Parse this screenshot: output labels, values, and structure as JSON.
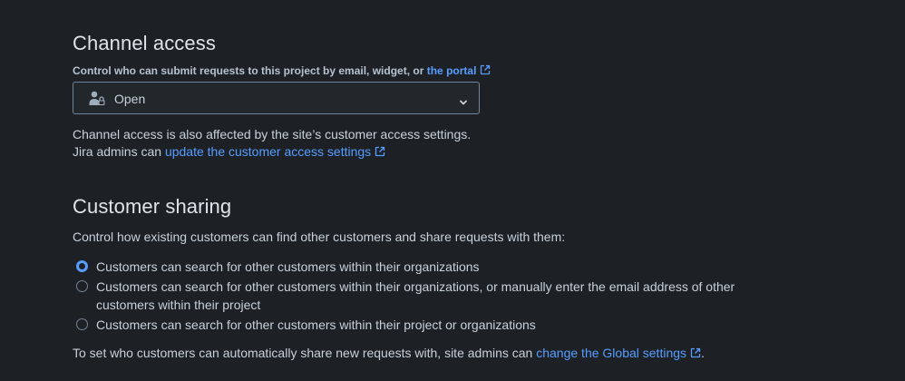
{
  "channel_access": {
    "title": "Channel access",
    "description": "Control who can submit requests to this project by email, widget, or",
    "portal_link": "the portal",
    "select": {
      "value": "Open",
      "icon": "person-lock-icon"
    },
    "note_line1": "Channel access is also affected by the site’s customer access settings.",
    "note_line2_prefix": "Jira admins can",
    "note_link": "update the customer access settings"
  },
  "customer_sharing": {
    "title": "Customer sharing",
    "description": "Control how existing customers can find other customers and share requests with them:",
    "options": [
      {
        "label": "Customers can search for other customers within their organizations",
        "checked": true
      },
      {
        "label": "Customers can search for other customers within their organizations, or manually enter the email address of other customers within their project",
        "checked": false
      },
      {
        "label": "Customers can search for other customers within their project or organizations",
        "checked": false
      }
    ],
    "footer_prefix": "To set who customers can automatically share new requests with, site admins can",
    "footer_link": "change the Global settings",
    "footer_suffix": "."
  },
  "colors": {
    "background": "#1d2125",
    "link": "#579dff",
    "text": "#c7d1db"
  }
}
